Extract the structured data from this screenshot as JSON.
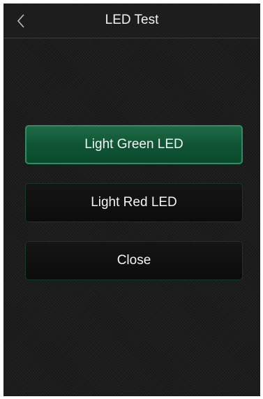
{
  "header": {
    "title": "LED Test",
    "back_icon": "chevron-left-icon"
  },
  "buttons": {
    "green": "Light Green LED",
    "red": "Light Red LED",
    "close": "Close"
  },
  "colors": {
    "background": "#1c1c1c",
    "accent_green": "#0f5535",
    "accent_border": "#2f8d63",
    "text": "#f4f4f4"
  }
}
